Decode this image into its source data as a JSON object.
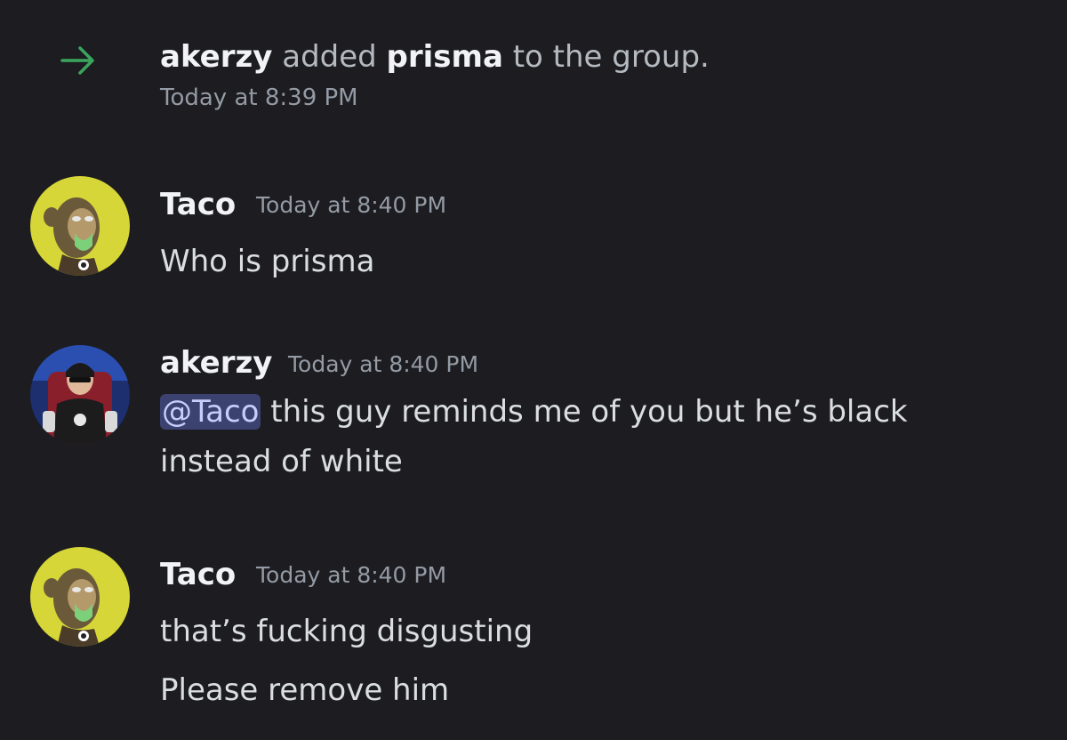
{
  "system_message": {
    "icon": "arrow-right-icon",
    "icon_color": "#3ba55d",
    "actor": "akerzy",
    "verb": " added ",
    "target": "prisma",
    "suffix": " to the group.",
    "timestamp": "Today at 8:39 PM"
  },
  "messages": [
    {
      "author": "Taco",
      "timestamp": "Today at 8:40 PM",
      "avatar": "ape-avatar",
      "lines": [
        "Who is prisma"
      ]
    },
    {
      "author": "akerzy",
      "timestamp": "Today at 8:40 PM",
      "avatar": "gamer-avatar",
      "mention": "@Taco",
      "line1_rest": " this guy reminds me of you but he’s black",
      "line2": "instead of white"
    },
    {
      "author": "Taco",
      "timestamp": "Today at 8:40 PM",
      "avatar": "ape-avatar",
      "lines": [
        "that’s fucking disgusting",
        "Please remove him"
      ]
    }
  ],
  "colors": {
    "background": "#1c1c21",
    "mention_bg": "#3c4270",
    "mention_text": "#c9cdfb"
  }
}
